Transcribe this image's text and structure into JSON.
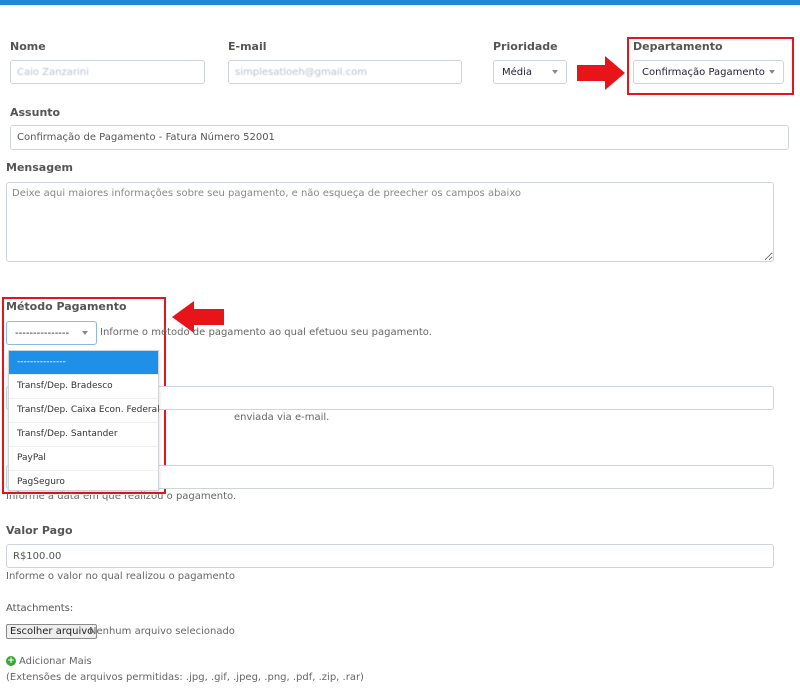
{
  "form": {
    "nome": {
      "label": "Nome",
      "value": "Caio Zanzarini"
    },
    "email": {
      "label": "E-mail",
      "value": "simplesatloeh@gmail.com"
    },
    "prioridade": {
      "label": "Prioridade",
      "value": "Média"
    },
    "departamento": {
      "label": "Departamento",
      "value": "Confirmação Pagamento"
    },
    "assunto": {
      "label": "Assunto",
      "value": "Confirmação de Pagamento - Fatura Número 52001"
    },
    "mensagem": {
      "label": "Mensagem",
      "placeholder": "Deixe aqui maiores informações sobre seu pagamento, e não esqueça de preecher os campos abaixo"
    },
    "metodo": {
      "label": "Método Pagamento",
      "value": "---------------",
      "help": "Informe o método de pagamento ao qual efetuou seu pagamento.",
      "options": [
        "---------------",
        "Transf/Dep. Bradesco",
        "Transf/Dep. Caixa Econ. Federal",
        "Transf/Dep. Santander",
        "PayPal",
        "PagSeguro"
      ]
    },
    "comprovante": {
      "help_partial": "enviada via e-mail."
    },
    "data": {
      "help": "Informe a data em que realizou o pagamento."
    },
    "valor": {
      "label": "Valor Pago",
      "value": "R$100.00",
      "help": "Informe o valor no qual realizou o pagamento"
    },
    "attachments": {
      "label": "Attachments:",
      "button": "Escolher arquivo",
      "status": "Nenhum arquivo selecionado",
      "add_more": "Adicionar Mais",
      "extensions": "(Extensões de arquivos permitidas: .jpg, .gif, .jpeg, .png, .pdf, .zip, .rar)"
    }
  },
  "colors": {
    "accent": "#1e88d8",
    "highlight": "#e8141a",
    "selected": "#1e90e8"
  }
}
